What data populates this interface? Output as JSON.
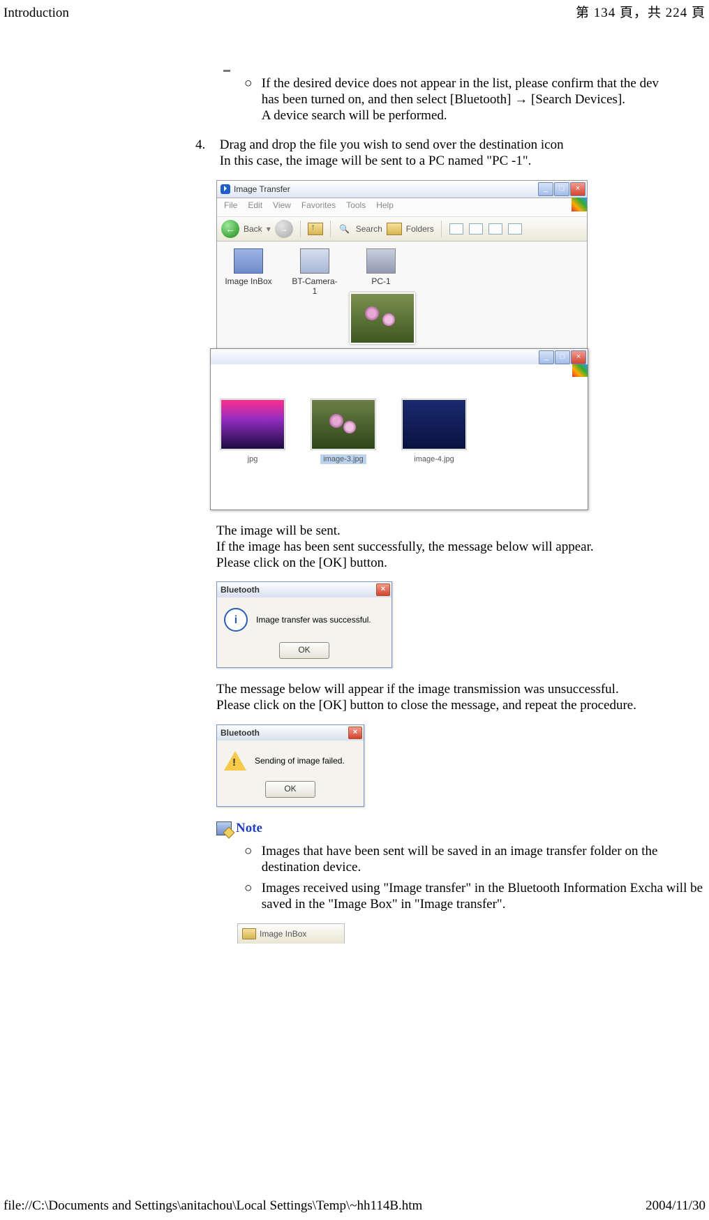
{
  "header": {
    "left": "Introduction",
    "right": "第 134 頁，共 224 頁"
  },
  "bullet1": {
    "l1": "If the desired device does not appear in the list, please confirm that the dev",
    "l2": "has been turned on, and then select [Bluetooth] → [Search Devices].",
    "l3": "A device search will be performed."
  },
  "step4": {
    "num": "4.",
    "l1": "Drag and drop the file you wish to send over the destination icon",
    "l2": "In this case, the image will be sent to a PC named \"PC -1\"."
  },
  "win1": {
    "title": "Image Transfer",
    "menu": {
      "file": "File",
      "edit": "Edit",
      "view": "View",
      "fav": "Favorites",
      "tools": "Tools",
      "help": "Help"
    },
    "toolbar": {
      "back": "Back",
      "search": "Search",
      "folders": "Folders"
    },
    "icons": {
      "inbox": "Image InBox",
      "camera": "BT-Camera-1",
      "pc": "PC-1"
    },
    "thumbs": {
      "t1": "jpg",
      "t2": "image-3.jpg",
      "t3": "image-4.jpg"
    }
  },
  "para1": {
    "l1": "The image will be sent.",
    "l2": "If the image has been sent successfully, the message below will appear.",
    "l3": "Please click on the [OK] button."
  },
  "dlg1": {
    "title": "Bluetooth",
    "msg": "Image transfer was successful.",
    "ok": "OK"
  },
  "para2": {
    "l1": "The message below will appear if the image transmission was unsuccessful.",
    "l2": "Please click on the [OK] button to close the message, and repeat the procedure."
  },
  "dlg2": {
    "title": "Bluetooth",
    "msg": "Sending of image failed.",
    "ok": "OK"
  },
  "note": {
    "header": "Note",
    "n1": "Images that have been sent will be saved in an image transfer folder on the destination device.",
    "n2": "Images received using \"Image transfer\" in the Bluetooth Information Excha will be saved in the \"Image Box\" in \"Image transfer\"."
  },
  "partial": {
    "label": "Image InBox"
  },
  "footer": {
    "left": "file://C:\\Documents and Settings\\anitachou\\Local Settings\\Temp\\~hh114B.htm",
    "right": "2004/11/30"
  }
}
